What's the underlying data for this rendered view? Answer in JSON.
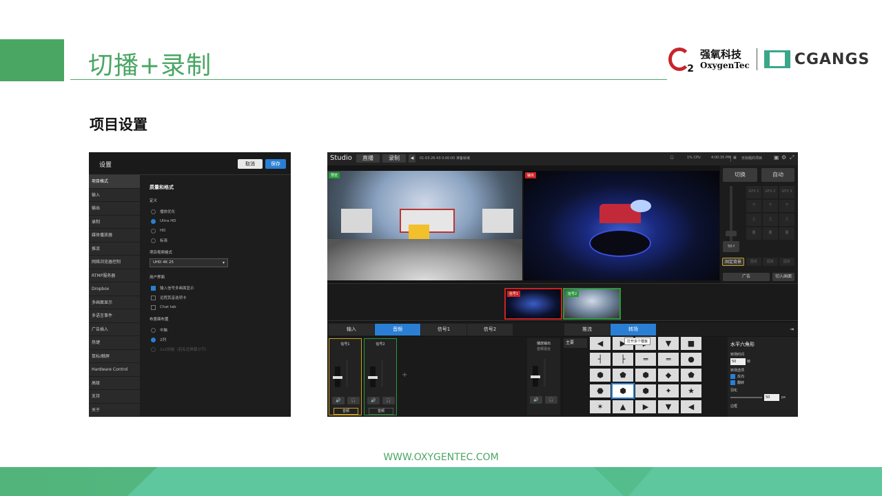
{
  "slide": {
    "title": "切播+录制",
    "subtitle": "项目设置",
    "url": "WWW.OXYGENTEC.COM",
    "logo": {
      "cn": "强氧科技",
      "en": "OxygenTec",
      "o2": "2",
      "partner": "CGANGS"
    },
    "colors": {
      "accent": "#4aa663",
      "save": "#2a7fd4"
    }
  },
  "settings": {
    "title": "设置",
    "cancel": "取消",
    "save": "保存",
    "sidebar": [
      "项目格式",
      "输入",
      "输出",
      "录制",
      "媒体播放器",
      "推流",
      "网络浏览器控制",
      "RTMP服务器",
      "Dropbox",
      "多画面显示",
      "多语言事件",
      "广告插入",
      "热键",
      "鼠标/触屏",
      "Hardware Control",
      "高级",
      "支持",
      "关于"
    ],
    "section": "质量和格式",
    "definition_label": "定义",
    "definitions": [
      "播放优化",
      "Ultra HD",
      "HD",
      "标清"
    ],
    "video_format_label": "项目视频格式",
    "video_format": "UHD 4K 25",
    "ui_label": "用户界面",
    "ui_options": [
      "输入信号多画面显示",
      "远程其音选项卡",
      "Chat tab"
    ],
    "layout_label": "布景面布置",
    "layout_options": [
      "中脑",
      "2列",
      "2x2网格（若有近屏幕分节）"
    ]
  },
  "studio": {
    "logo": "Studio",
    "tabs": [
      "直播",
      "录制"
    ],
    "info": "01:03:26:43  0:00:00  准备就绪",
    "cpu": "1% CPU",
    "time": "4:00:35 PM",
    "status_right": "无标题的项目",
    "preview_label": "预览",
    "program_label": "输出",
    "switch": "切换",
    "auto": "自动",
    "gfx": [
      "GFX 1",
      "GFX 2",
      "GFX 3"
    ],
    "updown": [
      "下",
      "下",
      "下",
      "上",
      "上",
      "上",
      "叠",
      "叠",
      "叠"
    ],
    "fader_val": "50 f",
    "fix_bg": "固定背景",
    "fix": "固定",
    "ad": "广告",
    "cut_in": "切入画面",
    "inputs": [
      {
        "label": "信号1",
        "state": "live"
      },
      {
        "label": "信号2",
        "state": "preview"
      }
    ],
    "lower_tabs": [
      "输入",
      "音频",
      "信号1",
      "信号2",
      "推流",
      "转场"
    ],
    "audio_channels": [
      {
        "label": "信号1",
        "name": "音频"
      },
      {
        "label": "信号2",
        "name": "音频"
      }
    ],
    "master_label": "播放输出",
    "master_sub": "音频混合",
    "main_label": "主要",
    "tooltip": "打开多个模板",
    "trans_title": "水平六角形",
    "duration_label": "转场时间",
    "duration": "50",
    "duration_unit": "帧",
    "dir_label": "转场选项",
    "dir_options": [
      "反向",
      "翻转"
    ],
    "soft_label": "羽化",
    "soft_val": "50",
    "soft_unit": "px",
    "border_label": "边框",
    "shapes": [
      "◀",
      "▶",
      "▶",
      "▼",
      "■",
      "┤",
      "├",
      "═",
      "═",
      "●",
      "⬢",
      "⬟",
      "⬢",
      "◆",
      "⬟",
      "⬣",
      "⬢",
      "⬢",
      "✦",
      "★",
      "✶",
      "▲",
      "▶",
      "▼",
      "◀"
    ]
  }
}
